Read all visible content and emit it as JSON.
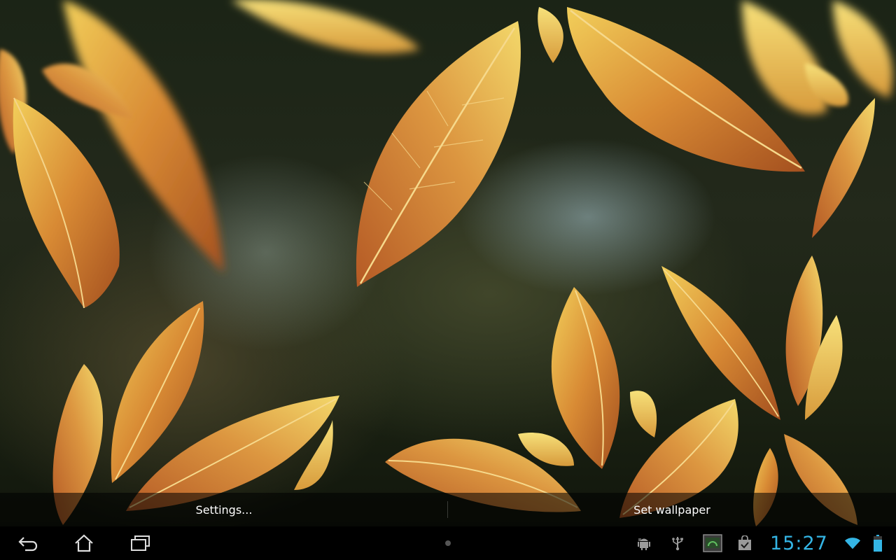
{
  "wallpaper_preview": {
    "settings_label": "Settings...",
    "set_wallpaper_label": "Set wallpaper"
  },
  "system_bar": {
    "nav": [
      {
        "name": "back-icon"
      },
      {
        "name": "home-icon"
      },
      {
        "name": "recent-apps-icon"
      }
    ],
    "tray_icons": [
      "android-debug-icon",
      "usb-icon",
      "screenshot-icon",
      "store-bag-icon"
    ],
    "clock": "15:27",
    "wifi": "wifi-icon",
    "battery": "battery-icon"
  },
  "colors": {
    "accent": "#34b5e5",
    "leaf_orange": "#d9862e",
    "leaf_yellow": "#e6c24a",
    "background_dark": "#1b2416"
  }
}
